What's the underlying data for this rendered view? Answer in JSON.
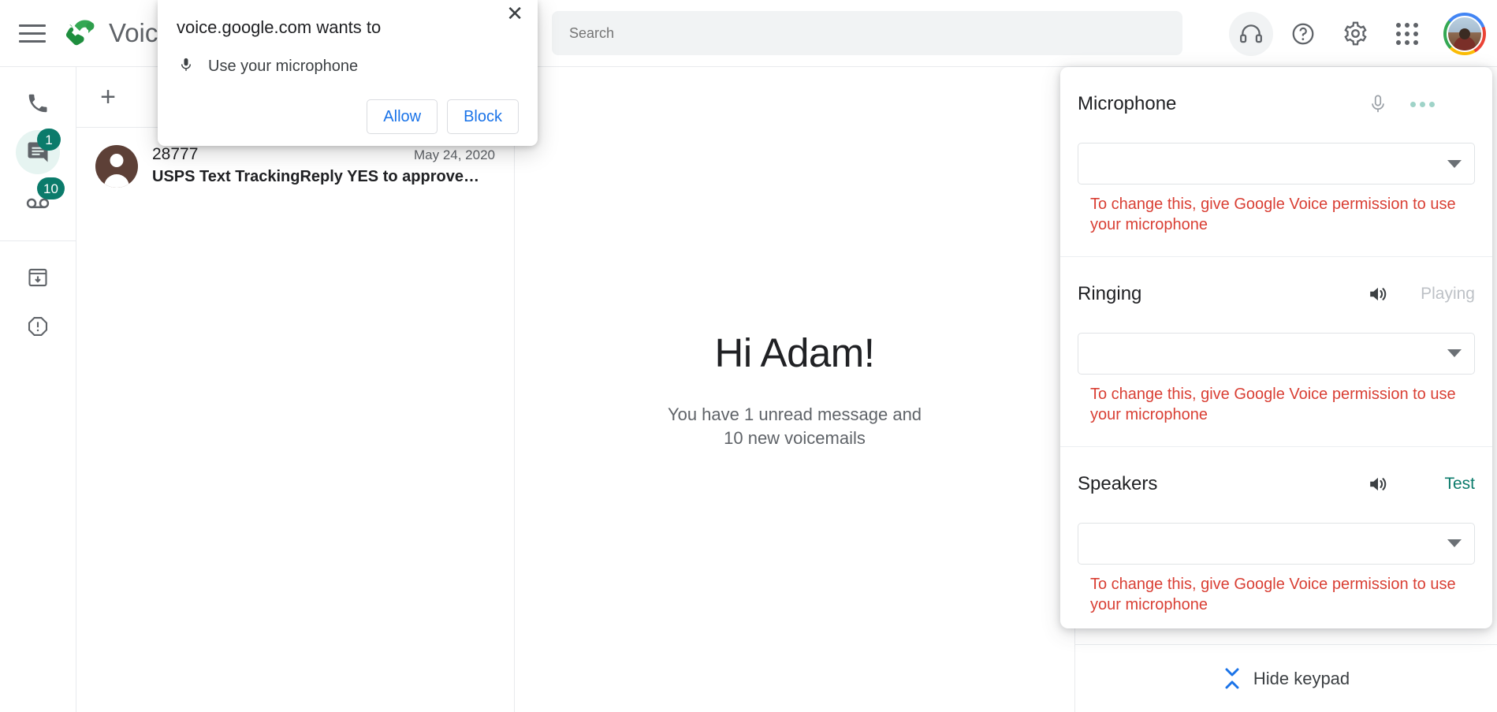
{
  "header": {
    "menu_icon": "hamburger-menu-icon",
    "brand": "Voice",
    "search_placeholder": "Search",
    "search_value": "",
    "icons": {
      "headset": "headset-icon",
      "help": "help-icon",
      "settings": "gear-icon",
      "apps": "apps-grid-icon",
      "avatar": "user-avatar"
    }
  },
  "rail": {
    "items": [
      {
        "name": "calls",
        "icon": "phone-icon",
        "badge": "",
        "selected": false
      },
      {
        "name": "messages",
        "icon": "message-icon",
        "badge": "1",
        "selected": true
      },
      {
        "name": "voicemail",
        "icon": "voicemail-icon",
        "badge": "10",
        "selected": false
      },
      {
        "name": "archive",
        "icon": "archive-icon",
        "badge": "",
        "selected": false
      },
      {
        "name": "spam",
        "icon": "spam-report-icon",
        "badge": "",
        "selected": false
      }
    ]
  },
  "list": {
    "new_button_label": "+",
    "toolbar_label": "",
    "messages": [
      {
        "sender": "28777",
        "date": "May 24, 2020",
        "preview": "USPS Text TrackingReply YES to approve…"
      }
    ]
  },
  "center": {
    "greeting": "Hi Adam!",
    "subtitle": "You have 1 unread message and 10 new voicemails"
  },
  "settings_popup": {
    "sections": [
      {
        "title": "Microphone",
        "icon": "microphone-icon",
        "action_label": "",
        "action_type": "dots",
        "select_value": "",
        "warning": "To change this, give Google Voice permission to use your microphone"
      },
      {
        "title": "Ringing",
        "icon": "speaker-volume-icon",
        "action_label": "Playing",
        "action_type": "muted",
        "select_value": "",
        "warning": "To change this, give Google Voice permission to use your microphone"
      },
      {
        "title": "Speakers",
        "icon": "speaker-volume-icon",
        "action_label": "Test",
        "action_type": "link",
        "select_value": "",
        "warning": "To change this, give Google Voice permission to use your microphone"
      }
    ]
  },
  "keypad_footer": {
    "label": "Hide keypad",
    "icon": "collapse-icon"
  },
  "permission_dialog": {
    "title": "voice.google.com wants to",
    "item_icon": "microphone-icon",
    "item_label": "Use your microphone",
    "allow_label": "Allow",
    "block_label": "Block",
    "close_label": "✕"
  },
  "colors": {
    "brand_green": "#0b7b6b",
    "badge_green": "#0b7b6b",
    "warning_red": "#d93f34",
    "link_blue": "#1a73e8",
    "icon_gray": "#5f6368"
  }
}
